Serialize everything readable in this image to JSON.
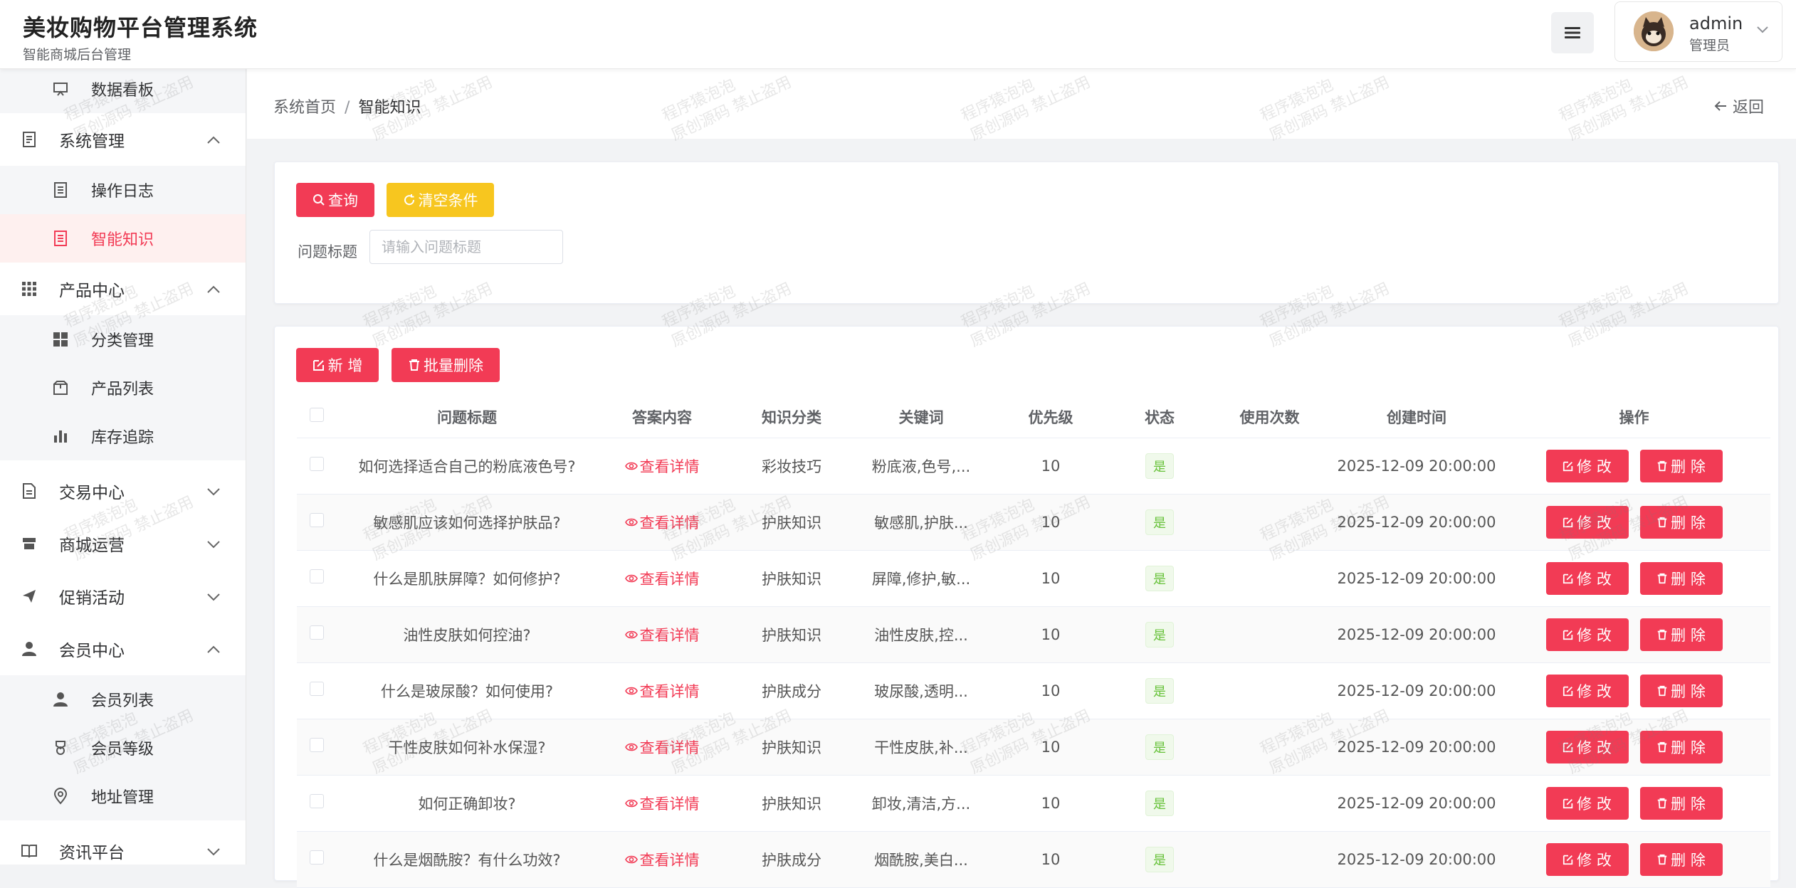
{
  "header": {
    "title": "美妆购物平台管理系统",
    "subtitle": "智能商城后台管理",
    "username": "admin",
    "role": "管理员"
  },
  "sidebar": {
    "items": [
      {
        "label": "数据看板",
        "icon": "chart-board-icon",
        "level": "sub"
      },
      {
        "label": "系统管理",
        "icon": "document-icon",
        "level": "top",
        "expanded": true
      },
      {
        "label": "操作日志",
        "icon": "log-icon",
        "level": "sub"
      },
      {
        "label": "智能知识",
        "icon": "knowledge-icon",
        "level": "sub",
        "active": true
      },
      {
        "label": "产品中心",
        "icon": "grid-icon",
        "level": "top",
        "expanded": true
      },
      {
        "label": "分类管理",
        "icon": "category-icon",
        "level": "sub"
      },
      {
        "label": "产品列表",
        "icon": "package-icon",
        "level": "sub"
      },
      {
        "label": "库存追踪",
        "icon": "bar-chart-icon",
        "level": "sub"
      },
      {
        "label": "交易中心",
        "icon": "file-icon",
        "level": "top",
        "expanded": false
      },
      {
        "label": "商城运营",
        "icon": "shop-icon",
        "level": "top",
        "expanded": false
      },
      {
        "label": "促销活动",
        "icon": "send-icon",
        "level": "top",
        "expanded": false
      },
      {
        "label": "会员中心",
        "icon": "user-icon",
        "level": "top",
        "expanded": true
      },
      {
        "label": "会员列表",
        "icon": "user-icon",
        "level": "sub"
      },
      {
        "label": "会员等级",
        "icon": "medal-icon",
        "level": "sub"
      },
      {
        "label": "地址管理",
        "icon": "location-icon",
        "level": "sub"
      },
      {
        "label": "资讯平台",
        "icon": "book-icon",
        "level": "top",
        "expanded": false
      }
    ]
  },
  "breadcrumb": {
    "home": "系统首页",
    "separator": "/",
    "current": "智能知识",
    "back": "返回"
  },
  "search": {
    "query_btn": "查询",
    "clear_btn": "清空条件",
    "field_label": "问题标题",
    "placeholder": "请输入问题标题"
  },
  "actions": {
    "add_btn": "新 增",
    "batch_delete_btn": "批量删除"
  },
  "table": {
    "headers": [
      "问题标题",
      "答案内容",
      "知识分类",
      "关键词",
      "优先级",
      "状态",
      "使用次数",
      "创建时间",
      "操作"
    ],
    "detail_link": "查看详情",
    "edit_btn": "修 改",
    "delete_btn": "删 除",
    "rows": [
      {
        "title": "如何选择适合自己的粉底液色号?",
        "category": "彩妆技巧",
        "keywords": "粉底液,色号,...",
        "priority": "10",
        "status": "是",
        "uses": "",
        "created": "2025-12-09 20:00:00"
      },
      {
        "title": "敏感肌应该如何选择护肤品?",
        "category": "护肤知识",
        "keywords": "敏感肌,护肤...",
        "priority": "10",
        "status": "是",
        "uses": "",
        "created": "2025-12-09 20:00:00"
      },
      {
        "title": "什么是肌肤屏障？如何修护?",
        "category": "护肤知识",
        "keywords": "屏障,修护,敏...",
        "priority": "10",
        "status": "是",
        "uses": "",
        "created": "2025-12-09 20:00:00"
      },
      {
        "title": "油性皮肤如何控油?",
        "category": "护肤知识",
        "keywords": "油性皮肤,控...",
        "priority": "10",
        "status": "是",
        "uses": "",
        "created": "2025-12-09 20:00:00"
      },
      {
        "title": "什么是玻尿酸？如何使用?",
        "category": "护肤成分",
        "keywords": "玻尿酸,透明...",
        "priority": "10",
        "status": "是",
        "uses": "",
        "created": "2025-12-09 20:00:00"
      },
      {
        "title": "干性皮肤如何补水保湿?",
        "category": "护肤知识",
        "keywords": "干性皮肤,补...",
        "priority": "10",
        "status": "是",
        "uses": "",
        "created": "2025-12-09 20:00:00"
      },
      {
        "title": "如何正确卸妆?",
        "category": "护肤知识",
        "keywords": "卸妆,清洁,方...",
        "priority": "10",
        "status": "是",
        "uses": "",
        "created": "2025-12-09 20:00:00"
      },
      {
        "title": "什么是烟酰胺？有什么功效?",
        "category": "护肤成分",
        "keywords": "烟酰胺,美白...",
        "priority": "10",
        "status": "是",
        "uses": "",
        "created": "2025-12-09 20:00:00"
      }
    ]
  },
  "watermark": {
    "line1": "程序猿泡泡",
    "line2": "原创源码 禁止盗用"
  },
  "colors": {
    "primary": "#f23b55",
    "warning": "#f7c61f",
    "success": "#67c23a",
    "active_bg": "#fef0ef"
  }
}
